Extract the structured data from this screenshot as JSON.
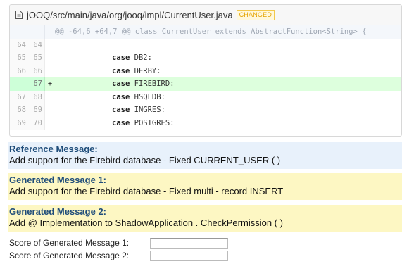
{
  "file": {
    "path": "jOOQ/src/main/java/org/jooq/impl/CurrentUser.java",
    "badge": "CHANGED",
    "icon": "file-icon"
  },
  "diff": {
    "hunk_header": "@@ -64,6 +64,7 @@ class CurrentUser extends AbstractFunction<String> {",
    "lines": [
      {
        "old": "64",
        "new": "64",
        "sign": "",
        "keyword": "",
        "rest": "",
        "type": "context"
      },
      {
        "old": "65",
        "new": "65",
        "sign": "",
        "keyword": "case",
        "rest": " DB2:",
        "type": "context"
      },
      {
        "old": "66",
        "new": "66",
        "sign": "",
        "keyword": "case",
        "rest": " DERBY:",
        "type": "context"
      },
      {
        "old": "",
        "new": "67",
        "sign": "+",
        "keyword": "case",
        "rest": " FIREBIRD:",
        "type": "added"
      },
      {
        "old": "67",
        "new": "68",
        "sign": "",
        "keyword": "case",
        "rest": " HSQLDB:",
        "type": "context"
      },
      {
        "old": "68",
        "new": "69",
        "sign": "",
        "keyword": "case",
        "rest": " INGRES:",
        "type": "context"
      },
      {
        "old": "69",
        "new": "70",
        "sign": "",
        "keyword": "case",
        "rest": " POSTGRES:",
        "type": "context"
      }
    ]
  },
  "messages": {
    "reference": {
      "title": "Reference Message:",
      "text": "Add support for the Firebird database - Fixed CURRENT_USER ( )"
    },
    "generated1": {
      "title": "Generated Message 1:",
      "text": "Add support for the Firebird database - Fixed multi - record INSERT"
    },
    "generated2": {
      "title": "Generated Message 2:",
      "text": "Add @ Implementation to ShadowApplication . CheckPermission ( )"
    }
  },
  "scores": {
    "label1": "Score of Generated Message 1:",
    "label2": "Score of Generated Message 2:",
    "value1": "",
    "value2": ""
  },
  "colors": {
    "added_bg": "#ddffdd",
    "reference_bg": "#e8f1fb",
    "generated_bg": "#fdf7c3",
    "title_color": "#1f4d7a"
  }
}
